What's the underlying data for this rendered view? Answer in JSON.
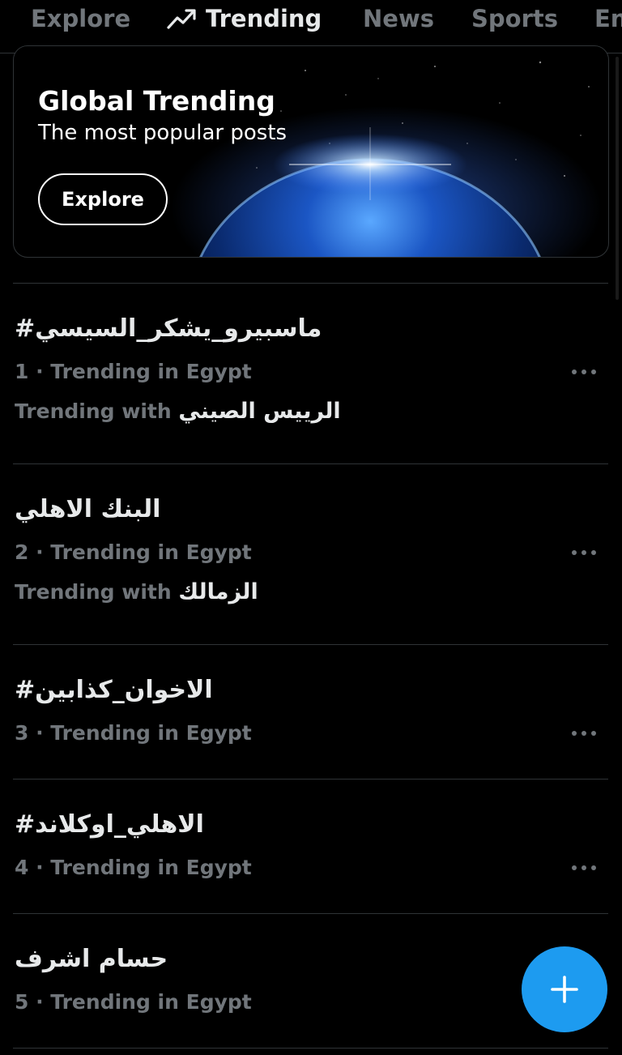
{
  "tabs": [
    {
      "label": "Explore",
      "active": false
    },
    {
      "label": "Trending",
      "active": true,
      "icon": "trending-arrow-icon"
    },
    {
      "label": "News",
      "active": false
    },
    {
      "label": "Sports",
      "active": false
    },
    {
      "label": "En",
      "active": false
    }
  ],
  "banner": {
    "title": "Global Trending",
    "subtitle": "The most popular posts",
    "button_label": "Explore"
  },
  "trends": [
    {
      "title": "#ماسبيرو_يشكر_السيسي",
      "meta": "1 · Trending in Egypt",
      "with_prefix": "Trending with ",
      "with_name": "الرييس الصيني"
    },
    {
      "title": "البنك الاهلي",
      "meta": "2 · Trending in Egypt",
      "with_prefix": "Trending with ",
      "with_name": "الزمالك"
    },
    {
      "title": "#الاخوان_كذابين",
      "meta": "3 · Trending in Egypt"
    },
    {
      "title": "#الاهلي_اوكلاند",
      "meta": "4 · Trending in Egypt"
    },
    {
      "title": "حسام اشرف",
      "meta": "5 · Trending in Egypt"
    }
  ],
  "colors": {
    "background": "#000000",
    "primary_text": "#e7e9ea",
    "secondary_text": "#71767b",
    "divider": "#2f3336",
    "accent": "#1d9bf0"
  },
  "icons": {
    "more": "more-horizontal-icon",
    "fab": "plus-icon"
  }
}
